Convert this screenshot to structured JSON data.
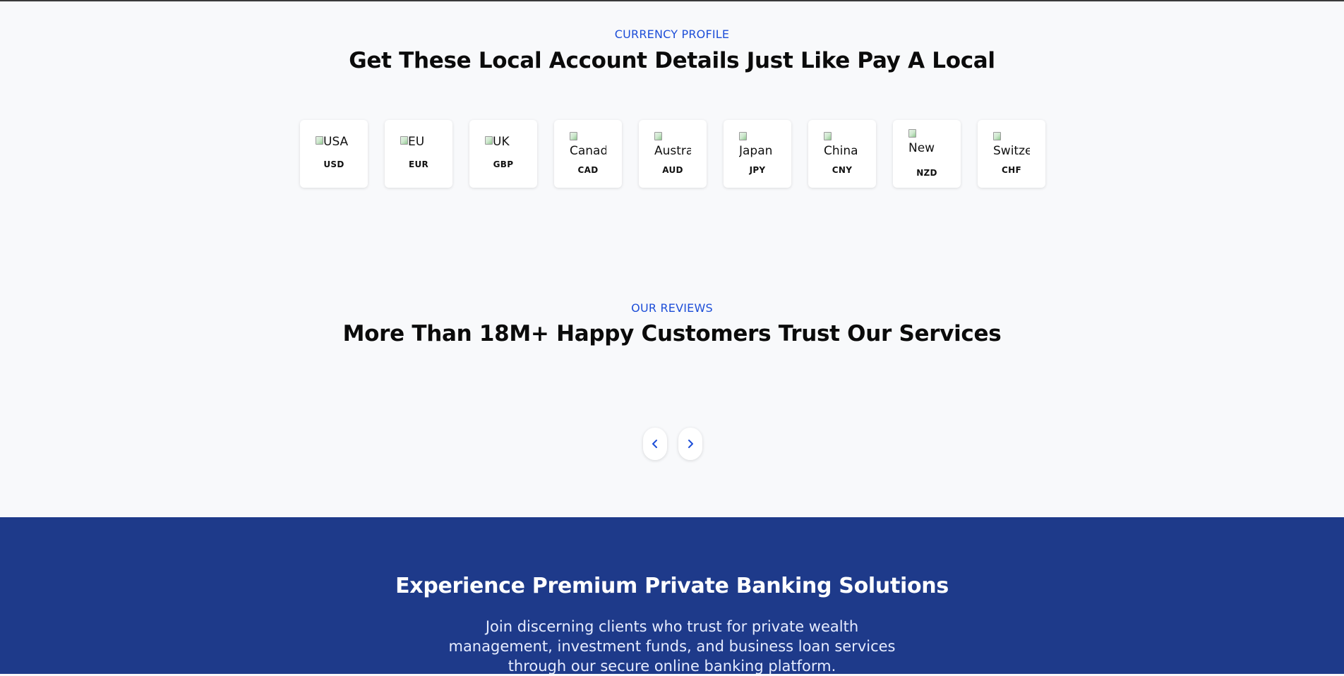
{
  "currency_section": {
    "eyebrow": "CURRENCY PROFILE",
    "title": "Get These Local Account Details Just Like Pay A Local",
    "cards": [
      {
        "flag_alt": "USA",
        "code": "USD"
      },
      {
        "flag_alt": "EU",
        "code": "EUR"
      },
      {
        "flag_alt": "UK",
        "code": "GBP"
      },
      {
        "flag_alt": "Canad",
        "code": "CAD"
      },
      {
        "flag_alt": "Austra",
        "code": "AUD"
      },
      {
        "flag_alt": "Japan",
        "code": "JPY"
      },
      {
        "flag_alt": "China",
        "code": "CNY"
      },
      {
        "flag_alt": "New Zeal",
        "code": "NZD"
      },
      {
        "flag_alt": "Switze",
        "code": "CHF"
      }
    ]
  },
  "reviews_section": {
    "eyebrow": "OUR REVIEWS",
    "title": "More Than 18M+ Happy Customers Trust Our Services",
    "prev_icon": "chevron-left-icon",
    "next_icon": "chevron-right-icon"
  },
  "cta_section": {
    "title": "Experience Premium Private Banking Solutions",
    "body": "Join discerning clients who trust for private wealth management, investment funds, and business loan services through our secure online banking platform."
  },
  "colors": {
    "accent": "#1d4ed8",
    "cta_background": "#1e3a8a",
    "page_background": "#f8f9fb"
  }
}
